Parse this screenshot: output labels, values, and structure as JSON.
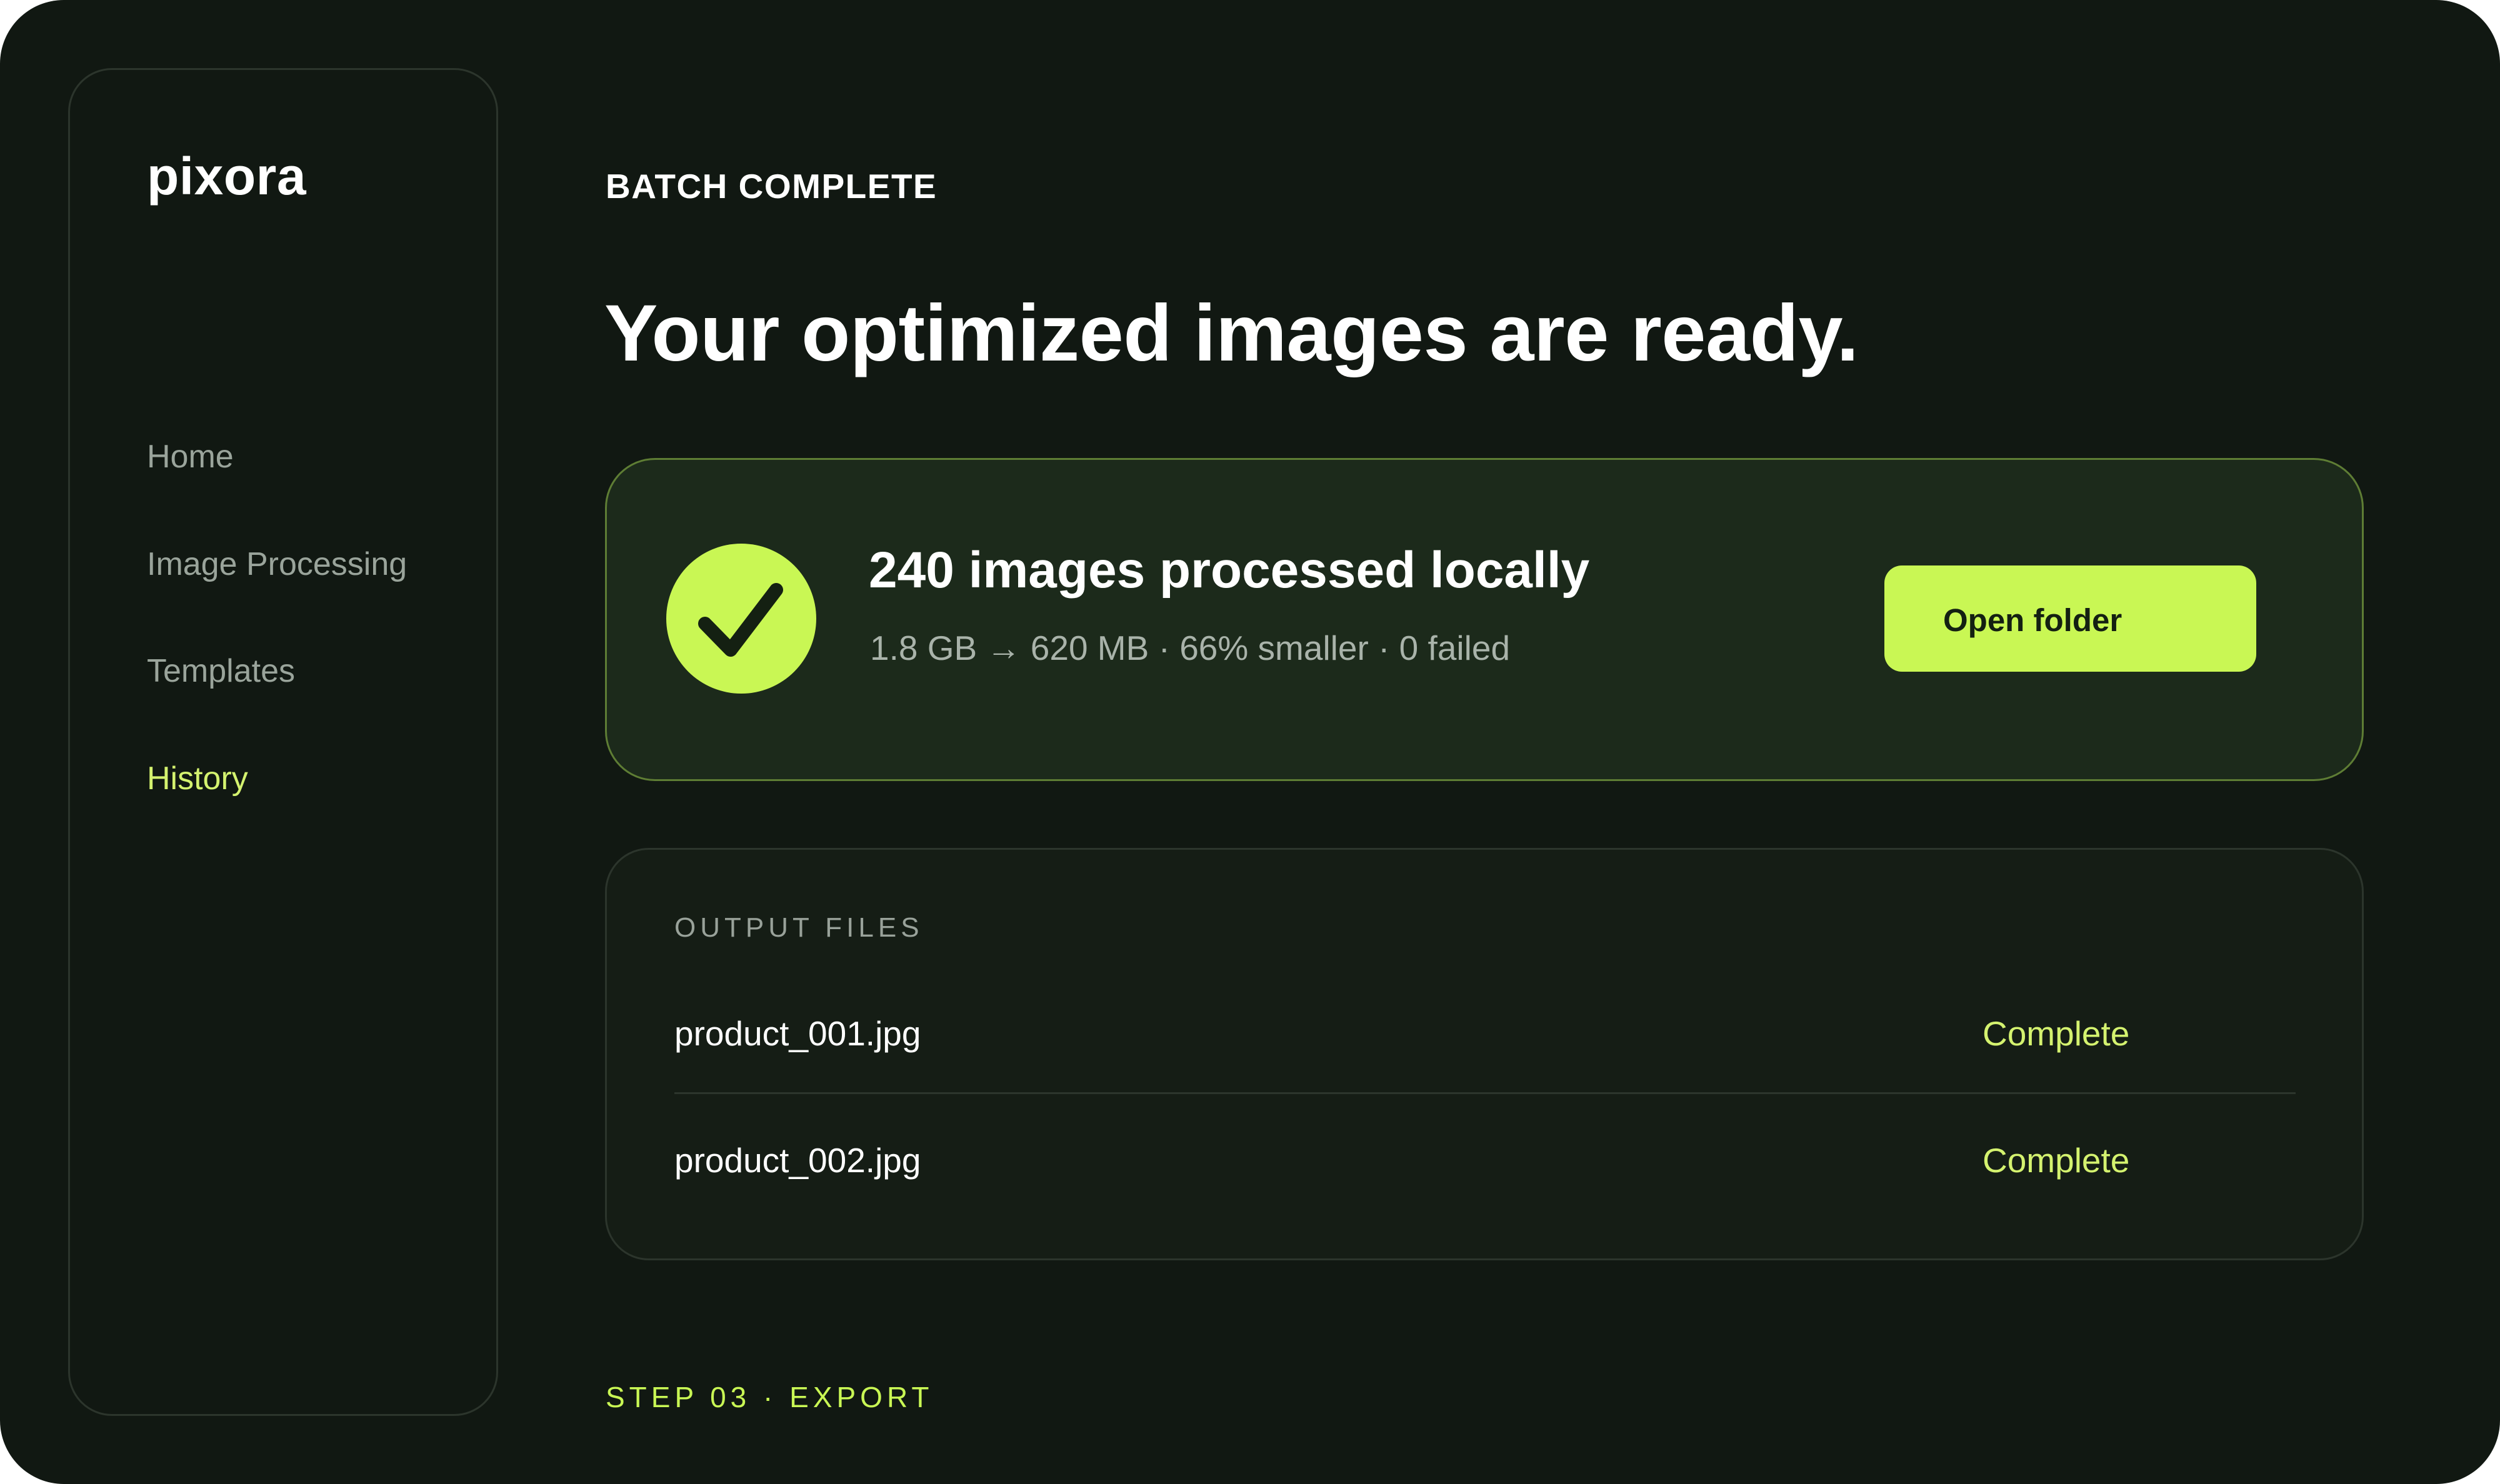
{
  "app": {
    "brand": "pixora"
  },
  "sidebar": {
    "items": [
      {
        "label": "Home",
        "active": false
      },
      {
        "label": "Image Processing",
        "active": false
      },
      {
        "label": "Templates",
        "active": false
      },
      {
        "label": "History",
        "active": true
      }
    ]
  },
  "main": {
    "eyebrow": "BATCH COMPLETE",
    "headline": "Your optimized images are ready.",
    "summary": {
      "icon": "check-circle-icon",
      "title": "240 images processed locally",
      "details": "1.8 GB → 620 MB · 66% smaller · 0 failed",
      "button_label": "Open folder"
    },
    "output": {
      "section_label": "OUTPUT FILES",
      "files": [
        {
          "name": "product_001.jpg",
          "status": "Complete"
        },
        {
          "name": "product_002.jpg",
          "status": "Complete"
        }
      ]
    },
    "footer": "STEP 03 · EXPORT"
  },
  "colors": {
    "background": "#111812",
    "accent": "#c9f754",
    "accent_text": "#d4f26f",
    "card": "#1c2a1b",
    "card_border": "#5e7d34",
    "muted_text": "#9aa49b"
  }
}
